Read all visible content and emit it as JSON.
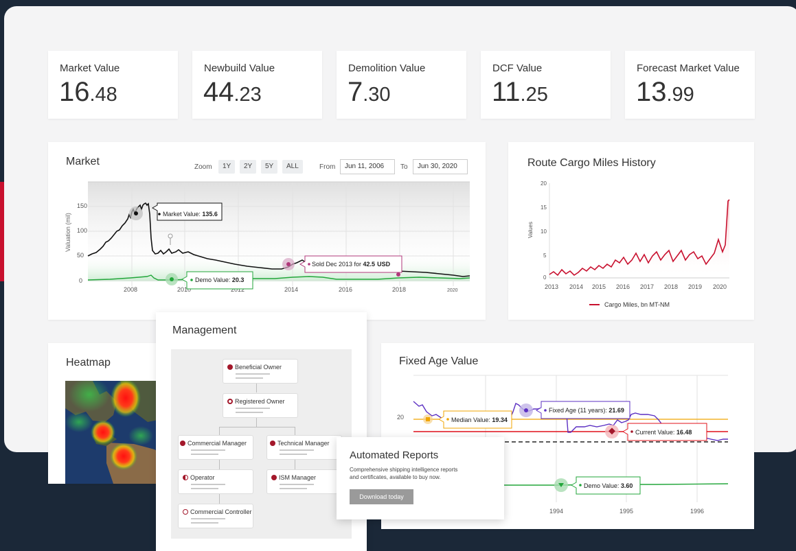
{
  "kpis": [
    {
      "label": "Market Value",
      "int": "16",
      "dec": ".48"
    },
    {
      "label": "Newbuild Value",
      "int": "44",
      "dec": ".23"
    },
    {
      "label": "Demolition Value",
      "int": "7",
      "dec": ".30"
    },
    {
      "label": "DCF Value",
      "int": "11",
      "dec": ".25"
    },
    {
      "label": "Forecast Market Value",
      "int": "13",
      "dec": ".99"
    }
  ],
  "market": {
    "title": "Market",
    "zoom_label": "Zoom",
    "zoom_options": [
      "1Y",
      "2Y",
      "5Y",
      "ALL"
    ],
    "from_label": "From",
    "from_value": "Jun 11, 2006",
    "to_label": "To",
    "to_value": "Jun 30, 2020",
    "ylabel": "Valuation (mil)",
    "y_ticks": [
      "150",
      "100",
      "50",
      "0"
    ],
    "x_ticks": [
      "2008",
      "2010",
      "2012",
      "2014",
      "2016",
      "2018",
      "2020"
    ],
    "tooltip_market": "Market Value: ",
    "tooltip_market_val": "135.6",
    "tooltip_sold": "Sold Dec 2013 for ",
    "tooltip_sold_val": "42.5",
    "tooltip_sold_unit": "USD",
    "tooltip_demo": "Demo Value: ",
    "tooltip_demo_val": "20.3"
  },
  "route": {
    "title": "Route Cargo Miles History",
    "ylabel": "Values",
    "legend": "Cargo Miles, bn MT-NM",
    "y_ticks": [
      "20",
      "15",
      "10",
      "5",
      "0"
    ],
    "x_ticks": [
      "2013",
      "2014",
      "2015",
      "2016",
      "2017",
      "2018",
      "2019",
      "2020"
    ]
  },
  "heatmap": {
    "title": "Heatmap"
  },
  "management": {
    "title": "Management",
    "nodes": {
      "beneficial": "Beneficial Owner",
      "registered": "Registered Owner",
      "commercial_manager": "Commercial Manager",
      "technical_manager": "Technical Manager",
      "operator": "Operator",
      "ism_manager": "ISM Manager",
      "commercial_controller": "Commercial Controller"
    }
  },
  "reports": {
    "title": "Automated Reports",
    "desc1": "Comprehensive shipping intelligence reports",
    "desc2": "and certificates, available to buy now.",
    "button": "Download today"
  },
  "fixed_age": {
    "title": "Fixed Age Value",
    "y_tick": "20",
    "x_ticks": [
      "1994",
      "1995",
      "1996"
    ],
    "tooltip_fixed": "Fixed Age (11 years): ",
    "tooltip_fixed_val": "21.69",
    "tooltip_median": "Median Value: ",
    "tooltip_median_val": "19.34",
    "tooltip_current": "Current Value: ",
    "tooltip_current_val": "16.48",
    "tooltip_demo": "Demo Value: ",
    "tooltip_demo_val": "3.60"
  },
  "colors": {
    "accent": "#c8102e",
    "background": "#1b2838",
    "demo_green": "#22a63a",
    "purple": "#5b2fc2"
  }
}
